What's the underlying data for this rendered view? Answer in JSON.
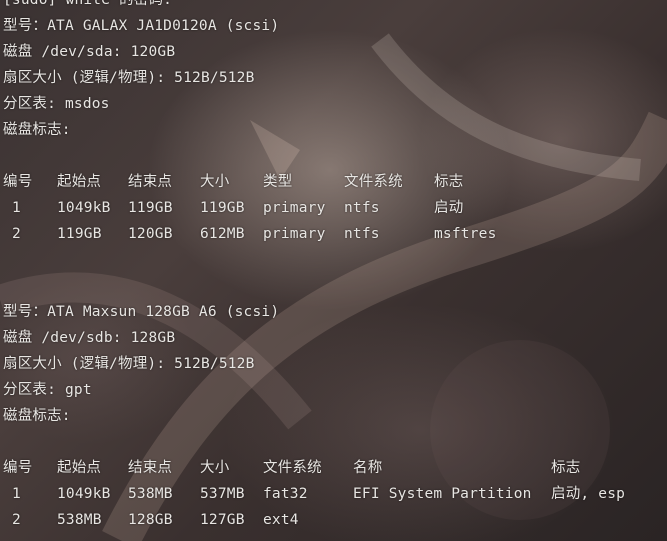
{
  "terminal": {
    "top_line": "[sudo] white 的密码:",
    "disk1": {
      "model": "型号：ATA GALAX JA1D0120A (scsi)",
      "disk": "磁盘 /dev/sda: 120GB",
      "sector": "扇区大小 (逻辑/物理): 512B/512B",
      "table": "分区表: msdos",
      "flags": "磁盘标志:",
      "headers": [
        "编号",
        "起始点",
        "结束点",
        "大小",
        "类型",
        "文件系统",
        "标志"
      ],
      "rows": [
        [
          "1",
          "1049kB",
          "119GB",
          "119GB",
          "primary",
          "ntfs",
          "启动"
        ],
        [
          "2",
          "119GB",
          "120GB",
          "612MB",
          "primary",
          "ntfs",
          "msftres"
        ]
      ]
    },
    "disk2": {
      "model": "型号：ATA Maxsun 128GB A6 (scsi)",
      "disk": "磁盘 /dev/sdb: 128GB",
      "sector": "扇区大小 (逻辑/物理): 512B/512B",
      "table": "分区表: gpt",
      "flags": "磁盘标志:",
      "headers": [
        "编号",
        "起始点",
        "结束点",
        "大小",
        "文件系统",
        "名称",
        "标志"
      ],
      "rows": [
        [
          "1",
          "1049kB",
          "538MB",
          "537MB",
          "fat32",
          "EFI System Partition",
          "启动, esp"
        ],
        [
          "2",
          "538MB",
          "128GB",
          "127GB",
          "ext4",
          "",
          ""
        ]
      ]
    }
  }
}
